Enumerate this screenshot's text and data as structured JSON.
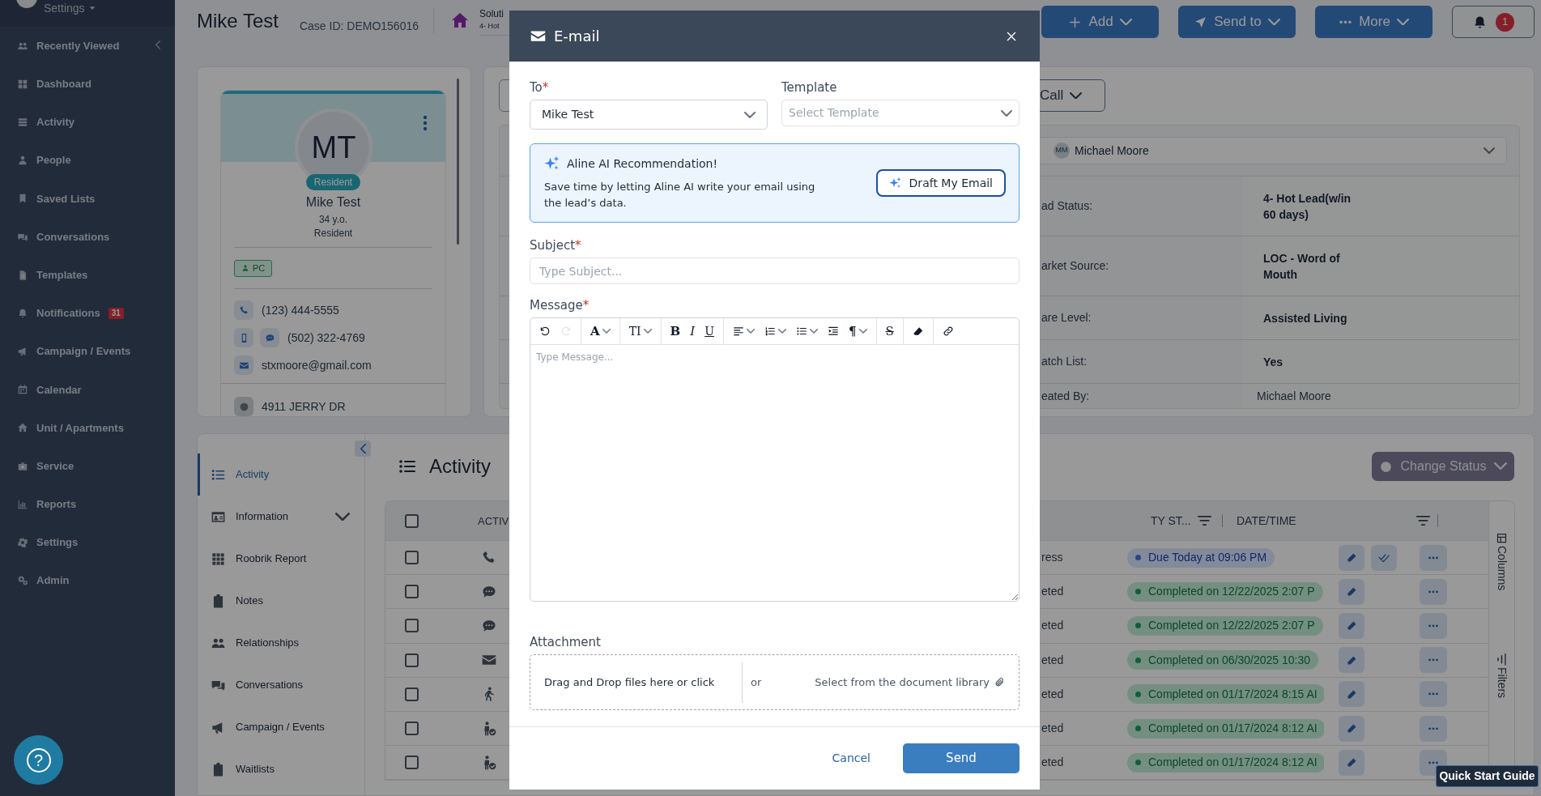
{
  "sidebar": {
    "user_menu": "Settings",
    "items": [
      {
        "label": "Recently Viewed"
      },
      {
        "label": "Dashboard"
      },
      {
        "label": "Activity"
      },
      {
        "label": "People"
      },
      {
        "label": "Saved Lists"
      },
      {
        "label": "Conversations"
      },
      {
        "label": "Templates"
      },
      {
        "label": "Notifications",
        "badge": "31"
      },
      {
        "label": "Campaign / Events"
      },
      {
        "label": "Calendar"
      },
      {
        "label": "Unit / Apartments"
      },
      {
        "label": "Service"
      },
      {
        "label": "Reports"
      },
      {
        "label": "Settings"
      },
      {
        "label": "Admin"
      }
    ]
  },
  "header": {
    "name": "Mike Test",
    "case_id": "Case ID: DEMO156016",
    "community": "Soluti",
    "community_status": "4- Hot",
    "buttons": [
      {
        "label": "Add"
      },
      {
        "label": "Send to"
      },
      {
        "label": "More"
      }
    ],
    "notification_count": "1"
  },
  "profile": {
    "initials": "MT",
    "role_badge": "Resident",
    "name": "Mike Test",
    "age": "34 y.o.",
    "type": "Resident",
    "tag": "PC",
    "contacts": [
      {
        "kind": "phone",
        "text": "(123) 444-5555"
      },
      {
        "kind": "mobile",
        "text": "(502) 322-4769"
      },
      {
        "kind": "email",
        "text": "stxmoore@gmail.com"
      },
      {
        "kind": "address",
        "text": "4911 JERRY DR"
      }
    ]
  },
  "details": {
    "call_button": "Call",
    "owner_initials": "MM",
    "owner": "Michael Moore",
    "rows": [
      {
        "label": "ad Status:",
        "value": "4- Hot Lead(w/in 60 days)",
        "emphasis": true
      },
      {
        "label": "arket Source:",
        "value": "LOC - Word of Mouth",
        "emphasis": true
      },
      {
        "label": "are Level:",
        "value": "Assisted Living",
        "emphasis": true
      },
      {
        "label": "atch List:",
        "value": "Yes",
        "emphasis": true
      },
      {
        "label": "eated By:",
        "value": "Michael Moore",
        "emphasis": false
      }
    ]
  },
  "section_nav": [
    {
      "label": "Activity",
      "selected": true,
      "expandable": false
    },
    {
      "label": "Information",
      "selected": false,
      "expandable": true
    },
    {
      "label": "Roobrik Report",
      "selected": false,
      "expandable": false
    },
    {
      "label": "Notes",
      "selected": false,
      "expandable": false
    },
    {
      "label": "Relationships",
      "selected": false,
      "expandable": false
    },
    {
      "label": "Conversations",
      "selected": false,
      "expandable": false
    },
    {
      "label": "Campaign / Events",
      "selected": false,
      "expandable": false
    },
    {
      "label": "Waitlists",
      "selected": false,
      "expandable": false
    }
  ],
  "activity": {
    "title": "Activity",
    "change_status": "Change Status",
    "columns": [
      "ACTIV",
      "TY ST...",
      "DATE/TIME"
    ],
    "side_tabs": [
      "Columns",
      "Filters"
    ],
    "header_checked": false,
    "rows": [
      {
        "checked": false,
        "kind": "phone",
        "status": "ress",
        "date": "Due Today at 09:06 PM",
        "completed": false,
        "can_complete": true
      },
      {
        "checked": false,
        "kind": "chat",
        "status": "eted",
        "date": "Completed on 12/22/2025 2:07 P",
        "completed": true,
        "can_complete": false
      },
      {
        "checked": false,
        "kind": "chat",
        "status": "eted",
        "date": "Completed on 12/22/2025 2:07 P",
        "completed": true,
        "can_complete": false
      },
      {
        "checked": false,
        "kind": "mail",
        "status": "eted",
        "date": "Completed on 06/30/2025 10:30",
        "completed": true,
        "can_complete": false
      },
      {
        "checked": false,
        "kind": "walk",
        "status": "eted",
        "date": "Completed on 01/17/2024 8:15 AI",
        "completed": true,
        "can_complete": false
      },
      {
        "checked": false,
        "kind": "personcheck",
        "status": "eted",
        "date": "Completed on 01/17/2024 8:12 AI",
        "completed": true,
        "can_complete": false
      },
      {
        "checked": false,
        "kind": "personcheck",
        "status": "eted",
        "date": "Completed on 01/17/2024 8:12 AI",
        "completed": true,
        "can_complete": false
      }
    ]
  },
  "modal": {
    "title": "E-mail",
    "to": {
      "label": "To",
      "mark": "*",
      "value": "Mike Test"
    },
    "template": {
      "label": "Template",
      "placeholder": "Select Template"
    },
    "ai": {
      "title": "Aline AI Recommendation!",
      "text": "Save time by letting Aline AI write your email using the lead’s data.",
      "button": "Draft My Email"
    },
    "subject": {
      "label": "Subject",
      "mark": "*",
      "placeholder": "Type Subject..."
    },
    "message": {
      "label": "Message",
      "mark": "*",
      "placeholder": "Type Message...",
      "toolbar": [
        {
          "tools": [
            {
              "kind": "undo",
              "disabled": false,
              "dropdown": false
            },
            {
              "kind": "redo",
              "disabled": true,
              "dropdown": false
            }
          ]
        },
        {
          "tools": [
            {
              "kind": "font_color",
              "glyph": "A",
              "disabled": false,
              "dropdown": true
            }
          ]
        },
        {
          "tools": [
            {
              "kind": "font_size",
              "glyph": "TI",
              "disabled": false,
              "dropdown": true
            }
          ]
        },
        {
          "tools": [
            {
              "kind": "bold",
              "glyph": "B",
              "disabled": false,
              "dropdown": false
            },
            {
              "kind": "italic",
              "glyph": "I",
              "disabled": false,
              "dropdown": false
            },
            {
              "kind": "underline",
              "glyph": "U",
              "disabled": false,
              "dropdown": false
            }
          ]
        },
        {
          "tools": [
            {
              "kind": "align",
              "disabled": false,
              "dropdown": true
            },
            {
              "kind": "ordered_list",
              "disabled": false,
              "dropdown": true
            },
            {
              "kind": "bullet_list",
              "disabled": false,
              "dropdown": true
            },
            {
              "kind": "indent",
              "disabled": false,
              "dropdown": false
            },
            {
              "kind": "paragraph",
              "glyph": "¶",
              "disabled": false,
              "dropdown": true
            }
          ]
        },
        {
          "tools": [
            {
              "kind": "strike",
              "glyph": "S",
              "disabled": false,
              "dropdown": false
            }
          ]
        },
        {
          "tools": [
            {
              "kind": "eraser",
              "disabled": false,
              "dropdown": false
            }
          ]
        },
        {
          "tools": [
            {
              "kind": "link",
              "disabled": false,
              "dropdown": false
            }
          ]
        }
      ]
    },
    "attachment": {
      "label": "Attachment",
      "drop": "Drag and Drop files here or click",
      "or": "or",
      "library": "Select from the document library"
    },
    "cancel": "Cancel",
    "send": "Send"
  },
  "help_button": "?",
  "quick_start": "Quick Start Guide"
}
